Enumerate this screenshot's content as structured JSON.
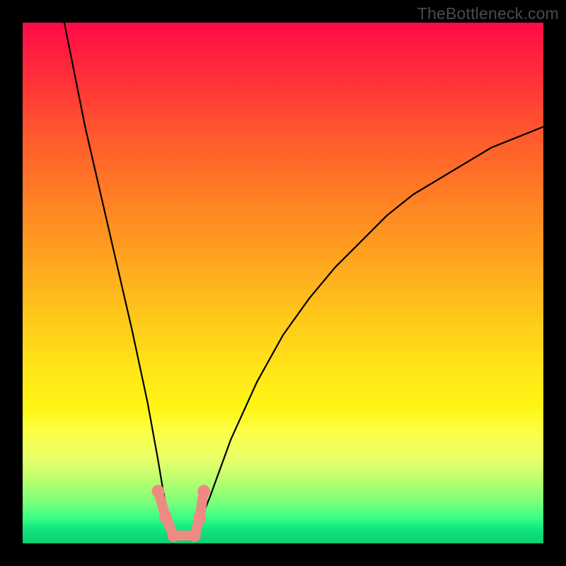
{
  "watermark": "TheBottleneck.com",
  "chart_data": {
    "type": "line",
    "title": "",
    "xlabel": "",
    "ylabel": "",
    "xlim": [
      0,
      100
    ],
    "ylim": [
      0,
      100
    ],
    "grid": false,
    "legend": false,
    "series": [
      {
        "name": "bottleneck-curve",
        "x": [
          8,
          10,
          12,
          15,
          18,
          21,
          24,
          26,
          27,
          28,
          29,
          30,
          31,
          32,
          33,
          34,
          36,
          40,
          45,
          50,
          55,
          60,
          65,
          70,
          75,
          80,
          85,
          90,
          95,
          100
        ],
        "y": [
          100,
          90,
          80,
          67,
          54,
          41,
          27,
          16,
          10,
          5,
          2,
          1,
          1,
          1,
          2,
          4,
          9,
          20,
          31,
          40,
          47,
          53,
          58,
          63,
          67,
          70,
          73,
          76,
          78,
          80
        ]
      }
    ],
    "markers": [
      {
        "name": "optimal-left-top",
        "x": 26.0,
        "y": 10.0
      },
      {
        "name": "optimal-left-mid",
        "x": 27.5,
        "y": 5.0
      },
      {
        "name": "optimal-trough-left",
        "x": 29.0,
        "y": 1.5
      },
      {
        "name": "optimal-trough-right",
        "x": 33.0,
        "y": 1.5
      },
      {
        "name": "optimal-right-mid",
        "x": 34.0,
        "y": 5.0
      },
      {
        "name": "optimal-right-top",
        "x": 34.8,
        "y": 10.0
      }
    ],
    "marker_segments": [
      {
        "from": "optimal-left-top",
        "to": "optimal-left-mid"
      },
      {
        "from": "optimal-left-mid",
        "to": "optimal-trough-left"
      },
      {
        "from": "optimal-trough-left",
        "to": "optimal-trough-right"
      },
      {
        "from": "optimal-trough-right",
        "to": "optimal-right-mid"
      },
      {
        "from": "optimal-right-mid",
        "to": "optimal-right-top"
      }
    ],
    "colors": {
      "curve": "#000000",
      "markers": "#ef8a82",
      "gradient_top": "#ff0b46",
      "gradient_bottom": "#0ccf72"
    }
  }
}
